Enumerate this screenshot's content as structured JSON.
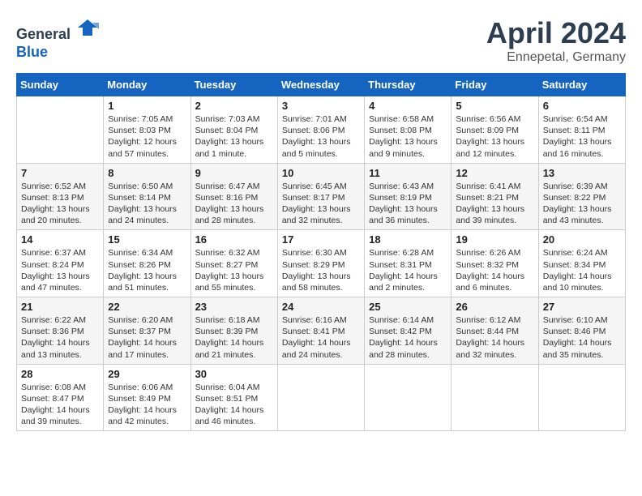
{
  "header": {
    "logo_general": "General",
    "logo_blue": "Blue",
    "month_title": "April 2024",
    "location": "Ennepetal, Germany"
  },
  "calendar": {
    "days_of_week": [
      "Sunday",
      "Monday",
      "Tuesday",
      "Wednesday",
      "Thursday",
      "Friday",
      "Saturday"
    ],
    "weeks": [
      [
        {
          "day": "",
          "info": ""
        },
        {
          "day": "1",
          "info": "Sunrise: 7:05 AM\nSunset: 8:03 PM\nDaylight: 12 hours\nand 57 minutes."
        },
        {
          "day": "2",
          "info": "Sunrise: 7:03 AM\nSunset: 8:04 PM\nDaylight: 13 hours\nand 1 minute."
        },
        {
          "day": "3",
          "info": "Sunrise: 7:01 AM\nSunset: 8:06 PM\nDaylight: 13 hours\nand 5 minutes."
        },
        {
          "day": "4",
          "info": "Sunrise: 6:58 AM\nSunset: 8:08 PM\nDaylight: 13 hours\nand 9 minutes."
        },
        {
          "day": "5",
          "info": "Sunrise: 6:56 AM\nSunset: 8:09 PM\nDaylight: 13 hours\nand 12 minutes."
        },
        {
          "day": "6",
          "info": "Sunrise: 6:54 AM\nSunset: 8:11 PM\nDaylight: 13 hours\nand 16 minutes."
        }
      ],
      [
        {
          "day": "7",
          "info": "Sunrise: 6:52 AM\nSunset: 8:13 PM\nDaylight: 13 hours\nand 20 minutes."
        },
        {
          "day": "8",
          "info": "Sunrise: 6:50 AM\nSunset: 8:14 PM\nDaylight: 13 hours\nand 24 minutes."
        },
        {
          "day": "9",
          "info": "Sunrise: 6:47 AM\nSunset: 8:16 PM\nDaylight: 13 hours\nand 28 minutes."
        },
        {
          "day": "10",
          "info": "Sunrise: 6:45 AM\nSunset: 8:17 PM\nDaylight: 13 hours\nand 32 minutes."
        },
        {
          "day": "11",
          "info": "Sunrise: 6:43 AM\nSunset: 8:19 PM\nDaylight: 13 hours\nand 36 minutes."
        },
        {
          "day": "12",
          "info": "Sunrise: 6:41 AM\nSunset: 8:21 PM\nDaylight: 13 hours\nand 39 minutes."
        },
        {
          "day": "13",
          "info": "Sunrise: 6:39 AM\nSunset: 8:22 PM\nDaylight: 13 hours\nand 43 minutes."
        }
      ],
      [
        {
          "day": "14",
          "info": "Sunrise: 6:37 AM\nSunset: 8:24 PM\nDaylight: 13 hours\nand 47 minutes."
        },
        {
          "day": "15",
          "info": "Sunrise: 6:34 AM\nSunset: 8:26 PM\nDaylight: 13 hours\nand 51 minutes."
        },
        {
          "day": "16",
          "info": "Sunrise: 6:32 AM\nSunset: 8:27 PM\nDaylight: 13 hours\nand 55 minutes."
        },
        {
          "day": "17",
          "info": "Sunrise: 6:30 AM\nSunset: 8:29 PM\nDaylight: 13 hours\nand 58 minutes."
        },
        {
          "day": "18",
          "info": "Sunrise: 6:28 AM\nSunset: 8:31 PM\nDaylight: 14 hours\nand 2 minutes."
        },
        {
          "day": "19",
          "info": "Sunrise: 6:26 AM\nSunset: 8:32 PM\nDaylight: 14 hours\nand 6 minutes."
        },
        {
          "day": "20",
          "info": "Sunrise: 6:24 AM\nSunset: 8:34 PM\nDaylight: 14 hours\nand 10 minutes."
        }
      ],
      [
        {
          "day": "21",
          "info": "Sunrise: 6:22 AM\nSunset: 8:36 PM\nDaylight: 14 hours\nand 13 minutes."
        },
        {
          "day": "22",
          "info": "Sunrise: 6:20 AM\nSunset: 8:37 PM\nDaylight: 14 hours\nand 17 minutes."
        },
        {
          "day": "23",
          "info": "Sunrise: 6:18 AM\nSunset: 8:39 PM\nDaylight: 14 hours\nand 21 minutes."
        },
        {
          "day": "24",
          "info": "Sunrise: 6:16 AM\nSunset: 8:41 PM\nDaylight: 14 hours\nand 24 minutes."
        },
        {
          "day": "25",
          "info": "Sunrise: 6:14 AM\nSunset: 8:42 PM\nDaylight: 14 hours\nand 28 minutes."
        },
        {
          "day": "26",
          "info": "Sunrise: 6:12 AM\nSunset: 8:44 PM\nDaylight: 14 hours\nand 32 minutes."
        },
        {
          "day": "27",
          "info": "Sunrise: 6:10 AM\nSunset: 8:46 PM\nDaylight: 14 hours\nand 35 minutes."
        }
      ],
      [
        {
          "day": "28",
          "info": "Sunrise: 6:08 AM\nSunset: 8:47 PM\nDaylight: 14 hours\nand 39 minutes."
        },
        {
          "day": "29",
          "info": "Sunrise: 6:06 AM\nSunset: 8:49 PM\nDaylight: 14 hours\nand 42 minutes."
        },
        {
          "day": "30",
          "info": "Sunrise: 6:04 AM\nSunset: 8:51 PM\nDaylight: 14 hours\nand 46 minutes."
        },
        {
          "day": "",
          "info": ""
        },
        {
          "day": "",
          "info": ""
        },
        {
          "day": "",
          "info": ""
        },
        {
          "day": "",
          "info": ""
        }
      ]
    ]
  }
}
